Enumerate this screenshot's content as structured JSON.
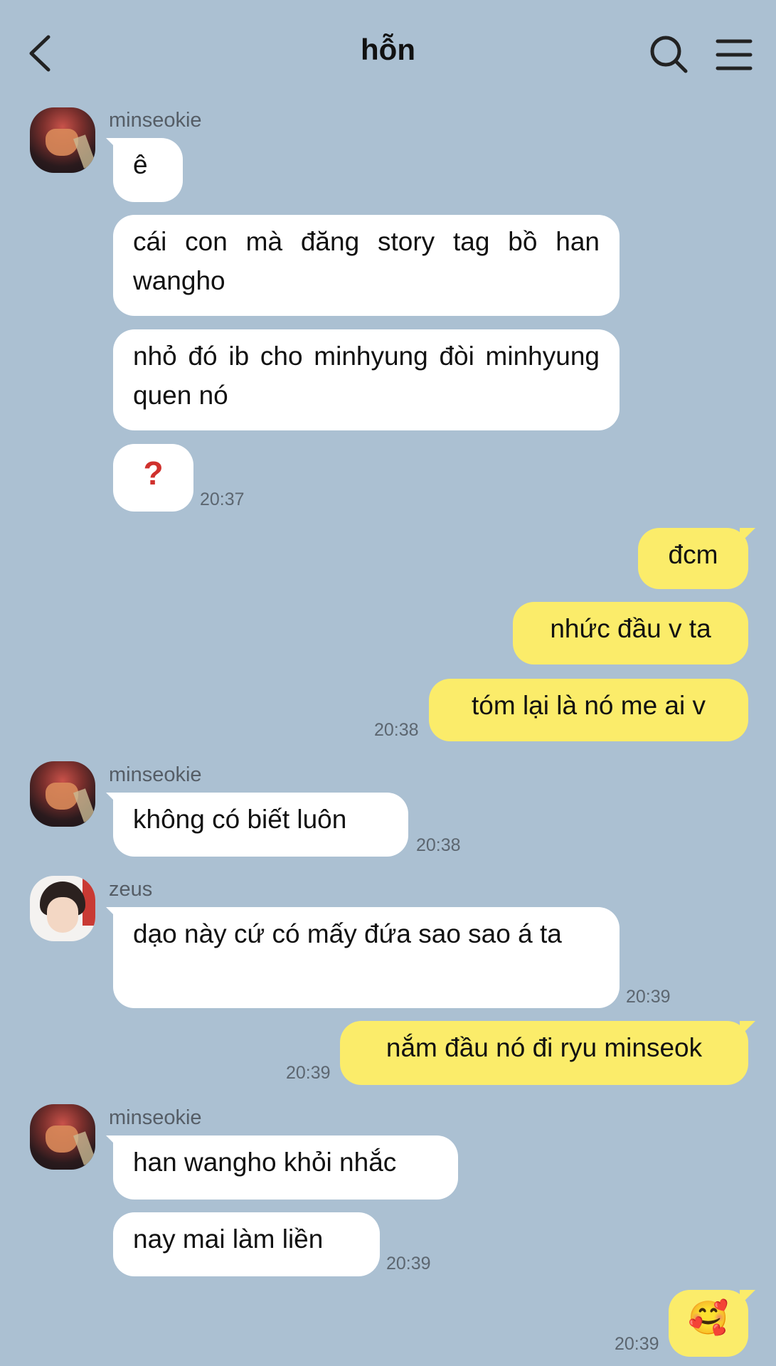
{
  "header": {
    "title": "hỗn"
  },
  "icons": {
    "back": "chevron-left-icon",
    "search": "search-icon",
    "menu": "hamburger-menu-icon"
  },
  "colors": {
    "background": "#abc0d2",
    "incoming_bubble": "#ffffff",
    "outgoing_bubble": "#fbec6a",
    "question_mark": "#d0312d"
  },
  "messages": [
    {
      "sender": "minseokie",
      "text": "ê"
    },
    {
      "text": "cái con mà đăng story tag bồ han wangho"
    },
    {
      "text": "nhỏ đó ib cho minhyung đòi minhyung quen nó"
    },
    {
      "text": "❓",
      "time": "20:37"
    },
    {
      "text": "đcm"
    },
    {
      "text": "nhức đầu v ta"
    },
    {
      "text": "tóm lại là nó me ai v",
      "time": "20:38"
    },
    {
      "sender": "minseokie",
      "text": "không có biết luôn",
      "time": "20:38"
    },
    {
      "sender": "zeus",
      "text": "dạo này cứ có mấy đứa sao sao á ta",
      "time": "20:39"
    },
    {
      "text": "nắm đầu nó đi ryu minseok",
      "time": "20:39"
    },
    {
      "sender": "minseokie",
      "text": "han wangho khỏi nhắc"
    },
    {
      "text": "nay mai làm liền",
      "time": "20:39"
    },
    {
      "text": "🥰",
      "time": "20:39"
    }
  ]
}
